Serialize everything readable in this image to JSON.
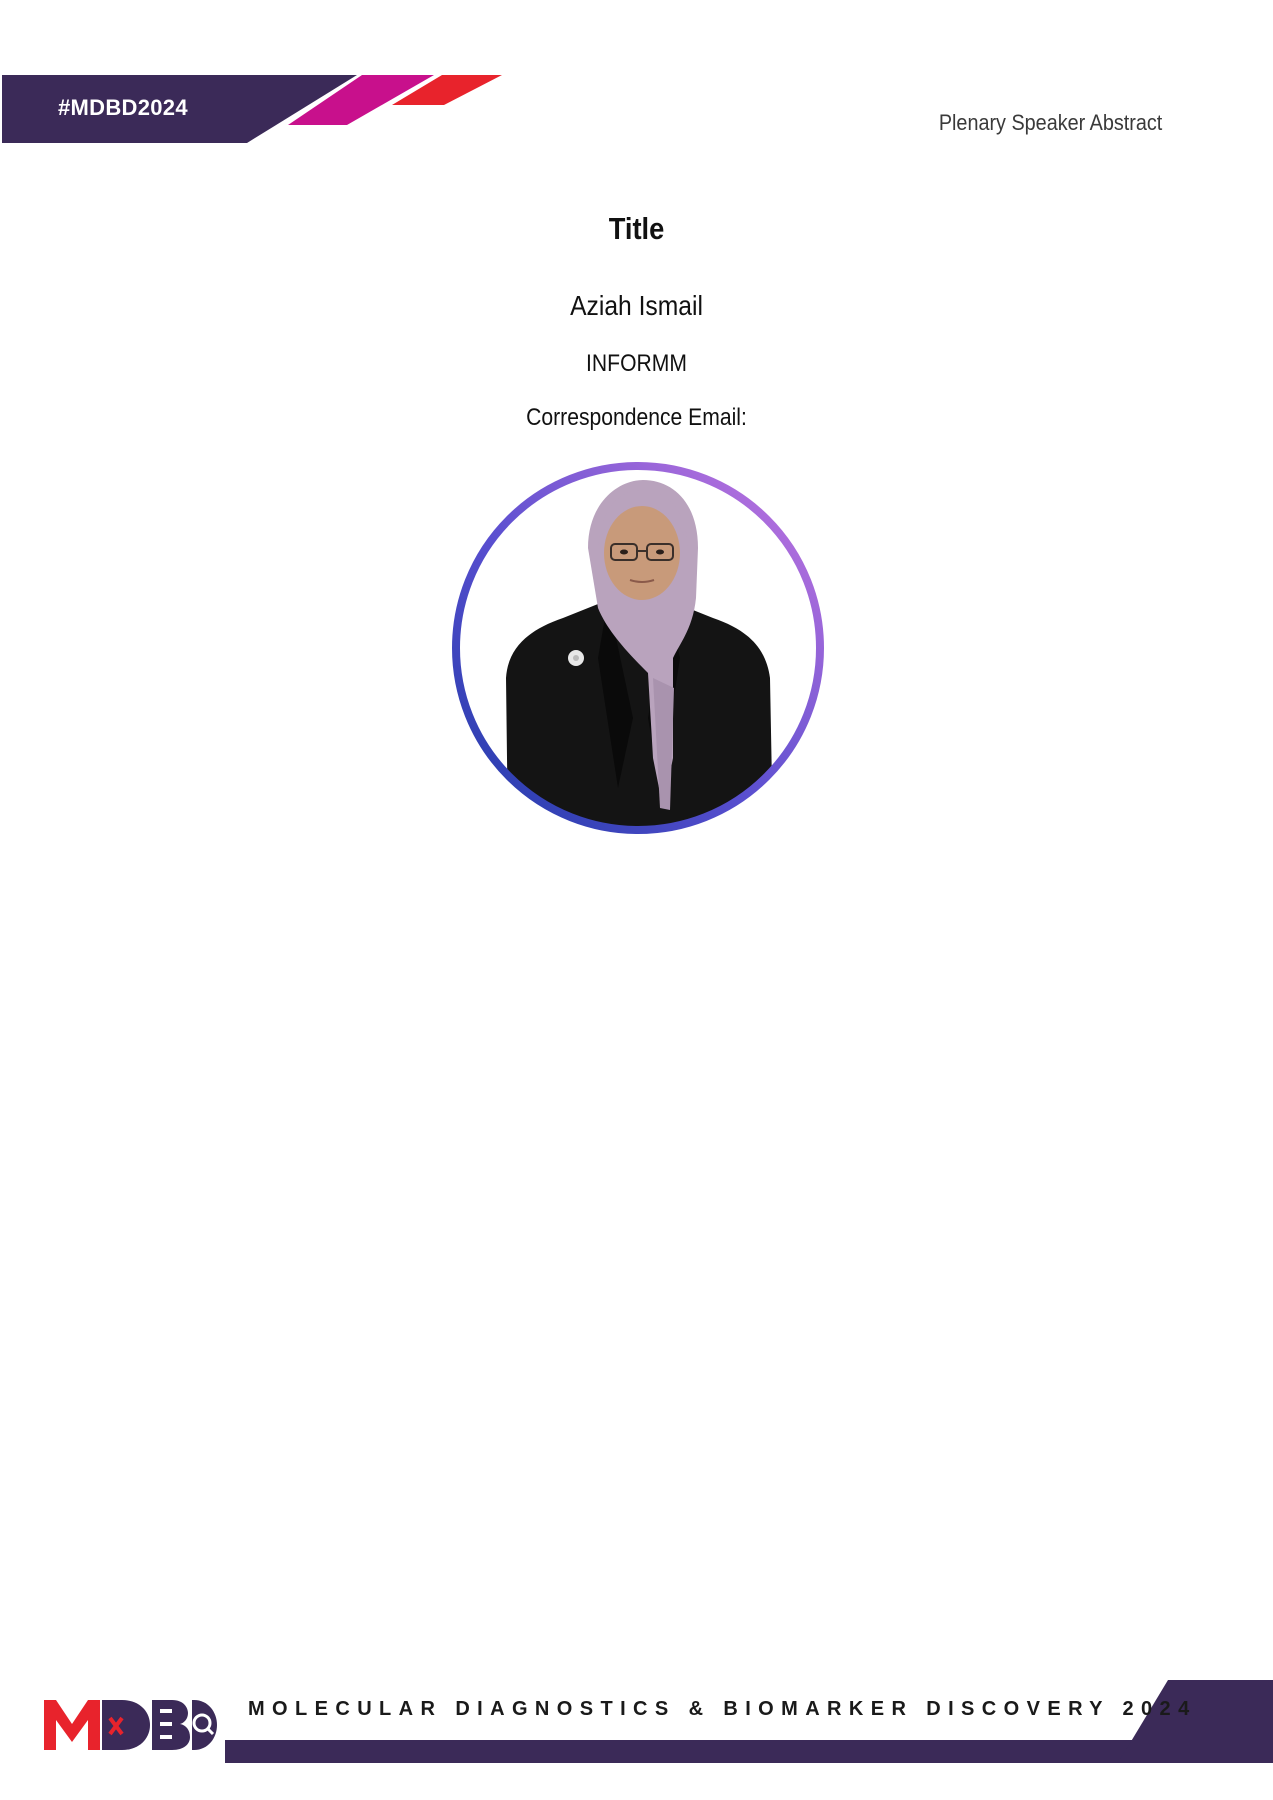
{
  "header": {
    "hashtag": "#MDBD2024",
    "section_label": "Plenary Speaker Abstract",
    "colors": {
      "navy": "#3b2a58",
      "magenta": "#c8108c",
      "red": "#e8232c"
    }
  },
  "abstract": {
    "title": "Title",
    "speaker_name": "Aziah Ismail",
    "affiliation": "INFORMM",
    "email_label": "Correspondence Email:"
  },
  "portrait": {
    "icon": "speaker-portrait-photo",
    "ring_gradient": [
      "#1f3aa8",
      "#c877e0"
    ]
  },
  "footer": {
    "logo_text": "MDBD",
    "logo_icon": "magnifier-icon",
    "tagline": "MOLECULAR DIAGNOSTICS & BIOMARKER DISCOVERY 2024",
    "colors": {
      "navy": "#3b2a58",
      "red": "#e8232c"
    }
  }
}
